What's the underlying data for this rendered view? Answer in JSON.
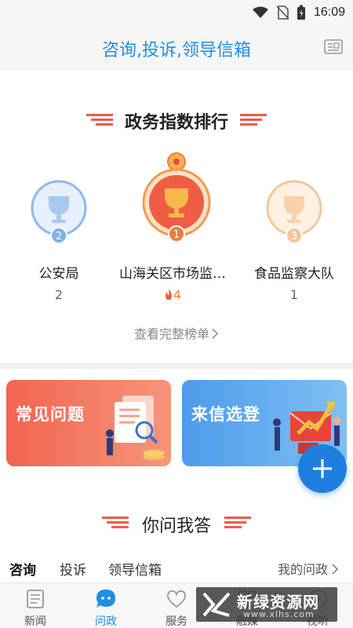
{
  "status": {
    "time": "16:09",
    "icons": [
      "wifi-icon",
      "no-sim-icon",
      "battery-icon"
    ]
  },
  "header": {
    "title": "咨询,投诉,领导信箱",
    "action_icon": "newspaper-icon"
  },
  "ranking": {
    "title": "政务指数排行",
    "items": [
      {
        "rank": "2",
        "name": "公安局",
        "value": "2",
        "color": "#7fb0e8"
      },
      {
        "rank": "1",
        "name": "山海关区市场监…",
        "value": "4",
        "color": "#f07c3e",
        "hot": true
      },
      {
        "rank": "3",
        "name": "食品监察大队",
        "value": "1",
        "color": "#f3c79c"
      }
    ],
    "view_all": "查看完整榜单"
  },
  "banners": [
    {
      "label": "常见问题",
      "color": "#f2735a",
      "icon": "documents-illustration"
    },
    {
      "label": "来信选登",
      "color": "#5aa6ea",
      "icon": "mailbox-chart-illustration"
    }
  ],
  "qa": {
    "title": "你问我答",
    "tabs": [
      "咨询",
      "投诉",
      "领导信箱"
    ],
    "my_link": "我的问政"
  },
  "nav": [
    {
      "label": "新闻",
      "icon": "news-icon"
    },
    {
      "label": "问政",
      "icon": "chat-bubble-icon",
      "active": true
    },
    {
      "label": "服务",
      "icon": "heart-icon"
    },
    {
      "label": "融媒",
      "icon": "grid-icon"
    },
    {
      "label": "视听",
      "icon": "play-icon"
    }
  ],
  "watermark": {
    "text": "新绿资源网",
    "sub": "www.xlhs.com"
  },
  "colors": {
    "accent": "#1f8fe0",
    "gold": "#f07c3e"
  }
}
